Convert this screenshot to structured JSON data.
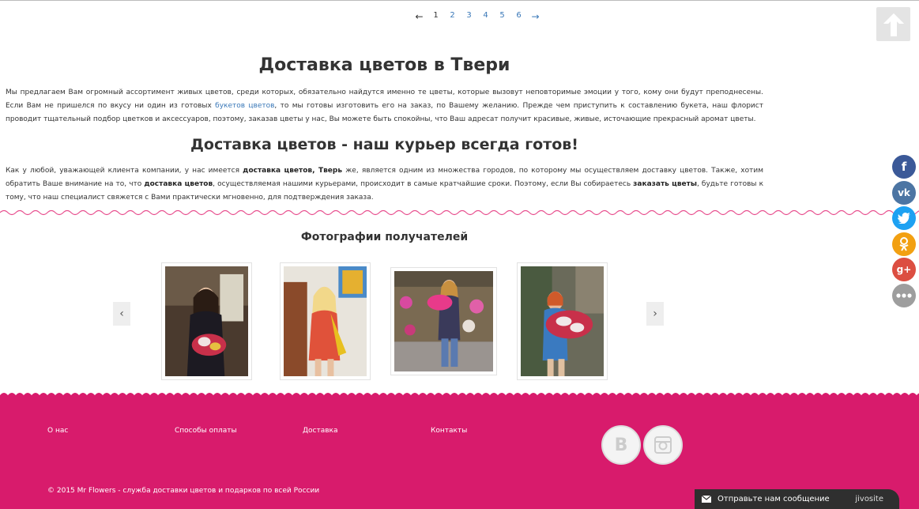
{
  "pagination": {
    "prev": "←",
    "pages": [
      "1",
      "2",
      "3",
      "4",
      "5",
      "6"
    ],
    "current": "1",
    "next": "→"
  },
  "main": {
    "title": "Доставка цветов в Твери",
    "para1_a": "Мы предлагаем Вам огромный ассортимент живых цветов, среди которых, обязательно найдутся именно те цветы, которые вызовут неповторимые эмоции у того, кому они будут преподнесены. Если Вам не пришелся по вкусу ни один из готовых ",
    "para1_link": "букетов цветов",
    "para1_b": ", то мы готовы изготовить его на заказ, по Вашему желанию. Прежде чем приступить к составлению букета, наш флорист проводит тщательный подбор цветков и аксессуаров, поэтому, заказав цветы у нас, Вы можете быть спокойны, что Ваш адресат получит красивые, живые, источающие прекрасный аромат цветы.",
    "subtitle": "Доставка цветов - наш курьер всегда готов!",
    "para2_a": "Как у любой, уважающей клиента компании, у нас имеется ",
    "para2_bold1": "доставка цветов, Тверь",
    "para2_b": " же, является одним из множества городов, по которому мы осуществляем доставку цветов. Также, хотим обратить Ваше внимание на то, что ",
    "para2_bold2": "доставка цветов",
    "para2_c": ", осуществляемая нашими курьерами, происходит в самые кратчайшие сроки. Поэтому, если Вы собираетесь ",
    "para2_bold3": "заказать цветы",
    "para2_d": ", будьте готовы к тому, что наш специалист свяжется с Вами практически мгновенно, для подтверждения заказа."
  },
  "photos": {
    "title": "Фотографии получателей",
    "prev": "‹",
    "next": "›"
  },
  "footer": {
    "links": [
      "О нас",
      "Способы оплаты",
      "Доставка",
      "Контакты"
    ],
    "copyright": "© 2015  Mr Flowers - служба доставки цветов и подарков по всей России"
  },
  "chat": {
    "label": "Отправьте нам сообщение",
    "brand": "jivosite"
  },
  "colors": {
    "accent": "#d81b6c",
    "link": "#3a78b8",
    "facebook": "#3b5998",
    "vk": "#4c75a3",
    "twitter": "#1da1f2",
    "odnoklassniki": "#f2a012",
    "googleplus": "#dc4e41",
    "more": "#9e9e9e"
  },
  "icons": {
    "scroll_top": "arrow-up-icon",
    "share": [
      "facebook-icon",
      "vk-icon",
      "twitter-icon",
      "odnoklassniki-icon",
      "google-plus-icon",
      "more-icon"
    ],
    "footer_social": [
      "vk-icon",
      "instagram-icon"
    ],
    "chat": "envelope-icon"
  }
}
